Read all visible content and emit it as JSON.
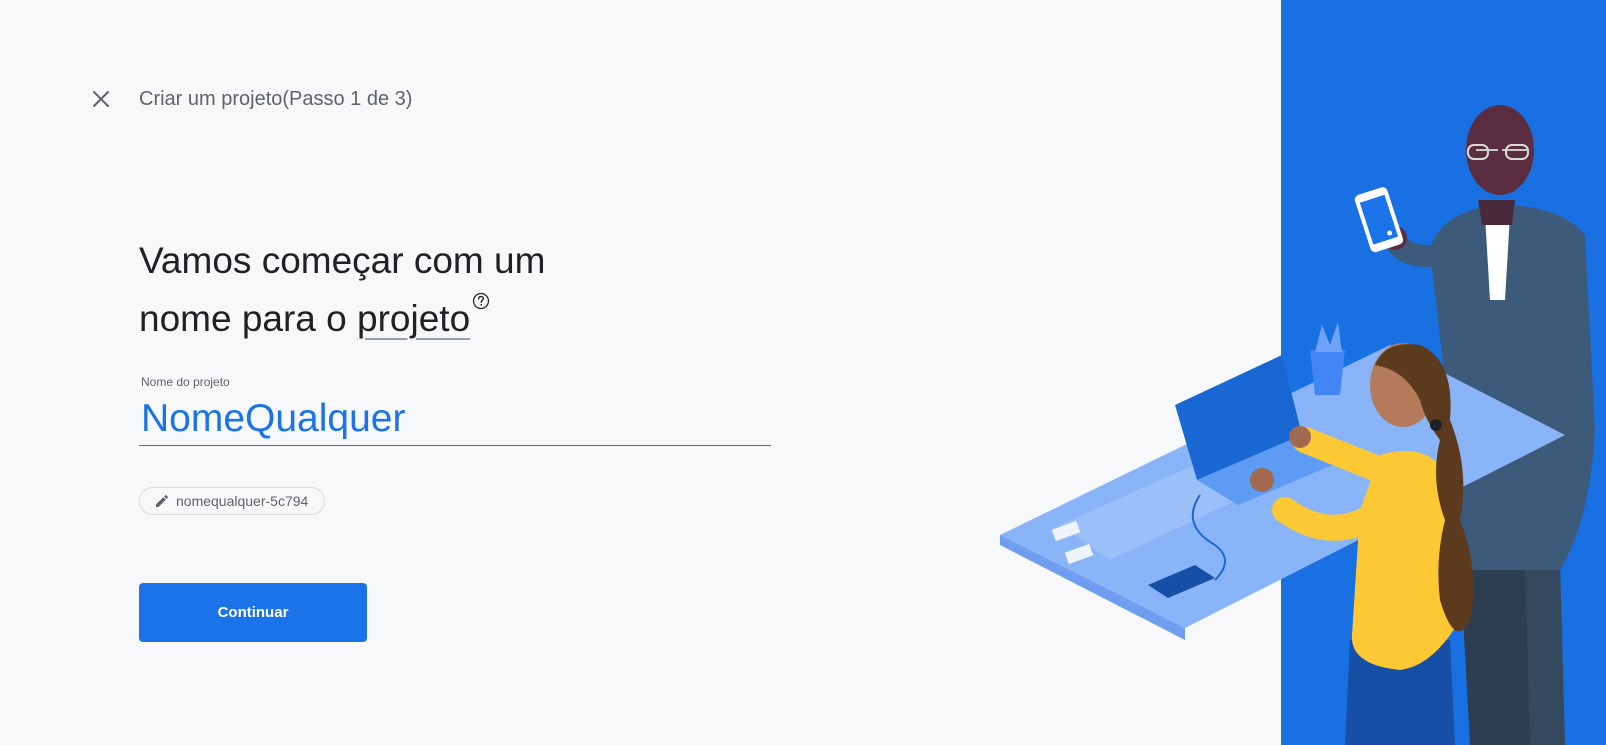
{
  "header": {
    "step_title": "Criar um projeto(Passo 1 de 3)"
  },
  "main": {
    "heading_line1": "Vamos começar com um",
    "heading_line2_prefix": "nome para o ",
    "heading_term": "projeto",
    "field_label": "Nome do projeto",
    "project_name_value": "NomeQualquer",
    "project_id": "nomequalquer-5c794",
    "continue_label": "Continuar"
  },
  "icons": {
    "close": "close-icon",
    "help": "help-circle-icon",
    "edit": "pencil-icon"
  },
  "colors": {
    "accent": "#1a73e8",
    "background": "#f7f8fa",
    "illustration_panel": "#1a73e8",
    "text_primary": "#202124",
    "text_secondary": "#5f6368"
  }
}
